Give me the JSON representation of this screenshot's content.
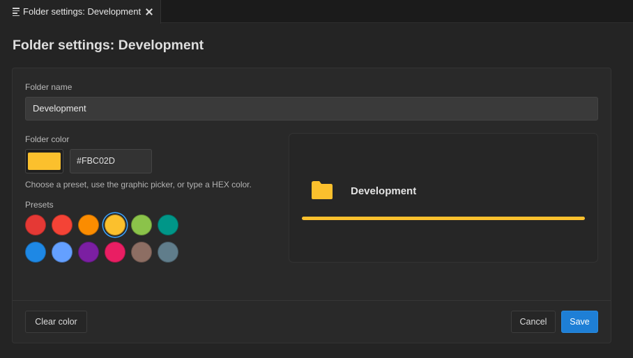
{
  "tab": {
    "icon": "document-lines-icon",
    "label": "Folder settings: Development",
    "close_icon": "close-icon"
  },
  "page": {
    "title": "Folder settings: Development"
  },
  "form": {
    "folder_name_label": "Folder name",
    "folder_name_value": "Development",
    "folder_color_label": "Folder color",
    "color_value": "#FBC02D",
    "hint": "Choose a preset, use the graphic picker, or type a HEX color.",
    "presets_label": "Presets",
    "presets": [
      {
        "color": "#E53935",
        "selected": false
      },
      {
        "color": "#F44336",
        "selected": false
      },
      {
        "color": "#FB8C00",
        "selected": false
      },
      {
        "color": "#FBC02D",
        "selected": true
      },
      {
        "color": "#8BC34A",
        "selected": false
      },
      {
        "color": "#009688",
        "selected": false
      },
      {
        "color": "#1E88E5",
        "selected": false
      },
      {
        "color": "#64A0FF",
        "selected": false
      },
      {
        "color": "#7B1FA2",
        "selected": false
      },
      {
        "color": "#E91E63",
        "selected": false
      },
      {
        "color": "#8D6E63",
        "selected": false
      },
      {
        "color": "#607D8B",
        "selected": false
      }
    ]
  },
  "preview": {
    "icon": "folder-icon",
    "name": "Development",
    "color": "#FBC02D"
  },
  "footer": {
    "clear_label": "Clear color",
    "cancel_label": "Cancel",
    "save_label": "Save"
  },
  "colors": {
    "accent": "#1E7FD6",
    "selection_ring": "#3AA3FF"
  }
}
